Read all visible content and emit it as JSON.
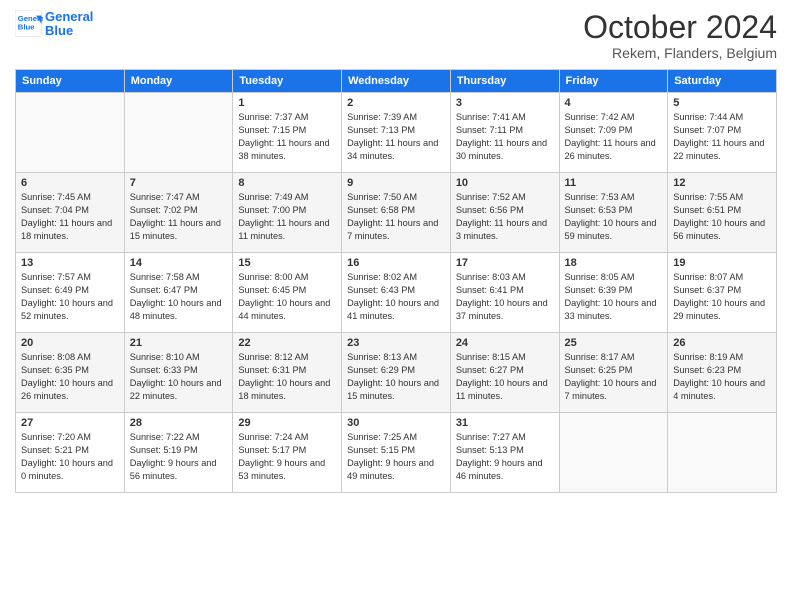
{
  "header": {
    "logo_line1": "General",
    "logo_line2": "Blue",
    "month": "October 2024",
    "location": "Rekem, Flanders, Belgium"
  },
  "days_of_week": [
    "Sunday",
    "Monday",
    "Tuesday",
    "Wednesday",
    "Thursday",
    "Friday",
    "Saturday"
  ],
  "weeks": [
    [
      {
        "day": "",
        "info": ""
      },
      {
        "day": "",
        "info": ""
      },
      {
        "day": "1",
        "info": "Sunrise: 7:37 AM\nSunset: 7:15 PM\nDaylight: 11 hours and 38 minutes."
      },
      {
        "day": "2",
        "info": "Sunrise: 7:39 AM\nSunset: 7:13 PM\nDaylight: 11 hours and 34 minutes."
      },
      {
        "day": "3",
        "info": "Sunrise: 7:41 AM\nSunset: 7:11 PM\nDaylight: 11 hours and 30 minutes."
      },
      {
        "day": "4",
        "info": "Sunrise: 7:42 AM\nSunset: 7:09 PM\nDaylight: 11 hours and 26 minutes."
      },
      {
        "day": "5",
        "info": "Sunrise: 7:44 AM\nSunset: 7:07 PM\nDaylight: 11 hours and 22 minutes."
      }
    ],
    [
      {
        "day": "6",
        "info": "Sunrise: 7:45 AM\nSunset: 7:04 PM\nDaylight: 11 hours and 18 minutes."
      },
      {
        "day": "7",
        "info": "Sunrise: 7:47 AM\nSunset: 7:02 PM\nDaylight: 11 hours and 15 minutes."
      },
      {
        "day": "8",
        "info": "Sunrise: 7:49 AM\nSunset: 7:00 PM\nDaylight: 11 hours and 11 minutes."
      },
      {
        "day": "9",
        "info": "Sunrise: 7:50 AM\nSunset: 6:58 PM\nDaylight: 11 hours and 7 minutes."
      },
      {
        "day": "10",
        "info": "Sunrise: 7:52 AM\nSunset: 6:56 PM\nDaylight: 11 hours and 3 minutes."
      },
      {
        "day": "11",
        "info": "Sunrise: 7:53 AM\nSunset: 6:53 PM\nDaylight: 10 hours and 59 minutes."
      },
      {
        "day": "12",
        "info": "Sunrise: 7:55 AM\nSunset: 6:51 PM\nDaylight: 10 hours and 56 minutes."
      }
    ],
    [
      {
        "day": "13",
        "info": "Sunrise: 7:57 AM\nSunset: 6:49 PM\nDaylight: 10 hours and 52 minutes."
      },
      {
        "day": "14",
        "info": "Sunrise: 7:58 AM\nSunset: 6:47 PM\nDaylight: 10 hours and 48 minutes."
      },
      {
        "day": "15",
        "info": "Sunrise: 8:00 AM\nSunset: 6:45 PM\nDaylight: 10 hours and 44 minutes."
      },
      {
        "day": "16",
        "info": "Sunrise: 8:02 AM\nSunset: 6:43 PM\nDaylight: 10 hours and 41 minutes."
      },
      {
        "day": "17",
        "info": "Sunrise: 8:03 AM\nSunset: 6:41 PM\nDaylight: 10 hours and 37 minutes."
      },
      {
        "day": "18",
        "info": "Sunrise: 8:05 AM\nSunset: 6:39 PM\nDaylight: 10 hours and 33 minutes."
      },
      {
        "day": "19",
        "info": "Sunrise: 8:07 AM\nSunset: 6:37 PM\nDaylight: 10 hours and 29 minutes."
      }
    ],
    [
      {
        "day": "20",
        "info": "Sunrise: 8:08 AM\nSunset: 6:35 PM\nDaylight: 10 hours and 26 minutes."
      },
      {
        "day": "21",
        "info": "Sunrise: 8:10 AM\nSunset: 6:33 PM\nDaylight: 10 hours and 22 minutes."
      },
      {
        "day": "22",
        "info": "Sunrise: 8:12 AM\nSunset: 6:31 PM\nDaylight: 10 hours and 18 minutes."
      },
      {
        "day": "23",
        "info": "Sunrise: 8:13 AM\nSunset: 6:29 PM\nDaylight: 10 hours and 15 minutes."
      },
      {
        "day": "24",
        "info": "Sunrise: 8:15 AM\nSunset: 6:27 PM\nDaylight: 10 hours and 11 minutes."
      },
      {
        "day": "25",
        "info": "Sunrise: 8:17 AM\nSunset: 6:25 PM\nDaylight: 10 hours and 7 minutes."
      },
      {
        "day": "26",
        "info": "Sunrise: 8:19 AM\nSunset: 6:23 PM\nDaylight: 10 hours and 4 minutes."
      }
    ],
    [
      {
        "day": "27",
        "info": "Sunrise: 7:20 AM\nSunset: 5:21 PM\nDaylight: 10 hours and 0 minutes."
      },
      {
        "day": "28",
        "info": "Sunrise: 7:22 AM\nSunset: 5:19 PM\nDaylight: 9 hours and 56 minutes."
      },
      {
        "day": "29",
        "info": "Sunrise: 7:24 AM\nSunset: 5:17 PM\nDaylight: 9 hours and 53 minutes."
      },
      {
        "day": "30",
        "info": "Sunrise: 7:25 AM\nSunset: 5:15 PM\nDaylight: 9 hours and 49 minutes."
      },
      {
        "day": "31",
        "info": "Sunrise: 7:27 AM\nSunset: 5:13 PM\nDaylight: 9 hours and 46 minutes."
      },
      {
        "day": "",
        "info": ""
      },
      {
        "day": "",
        "info": ""
      }
    ]
  ]
}
